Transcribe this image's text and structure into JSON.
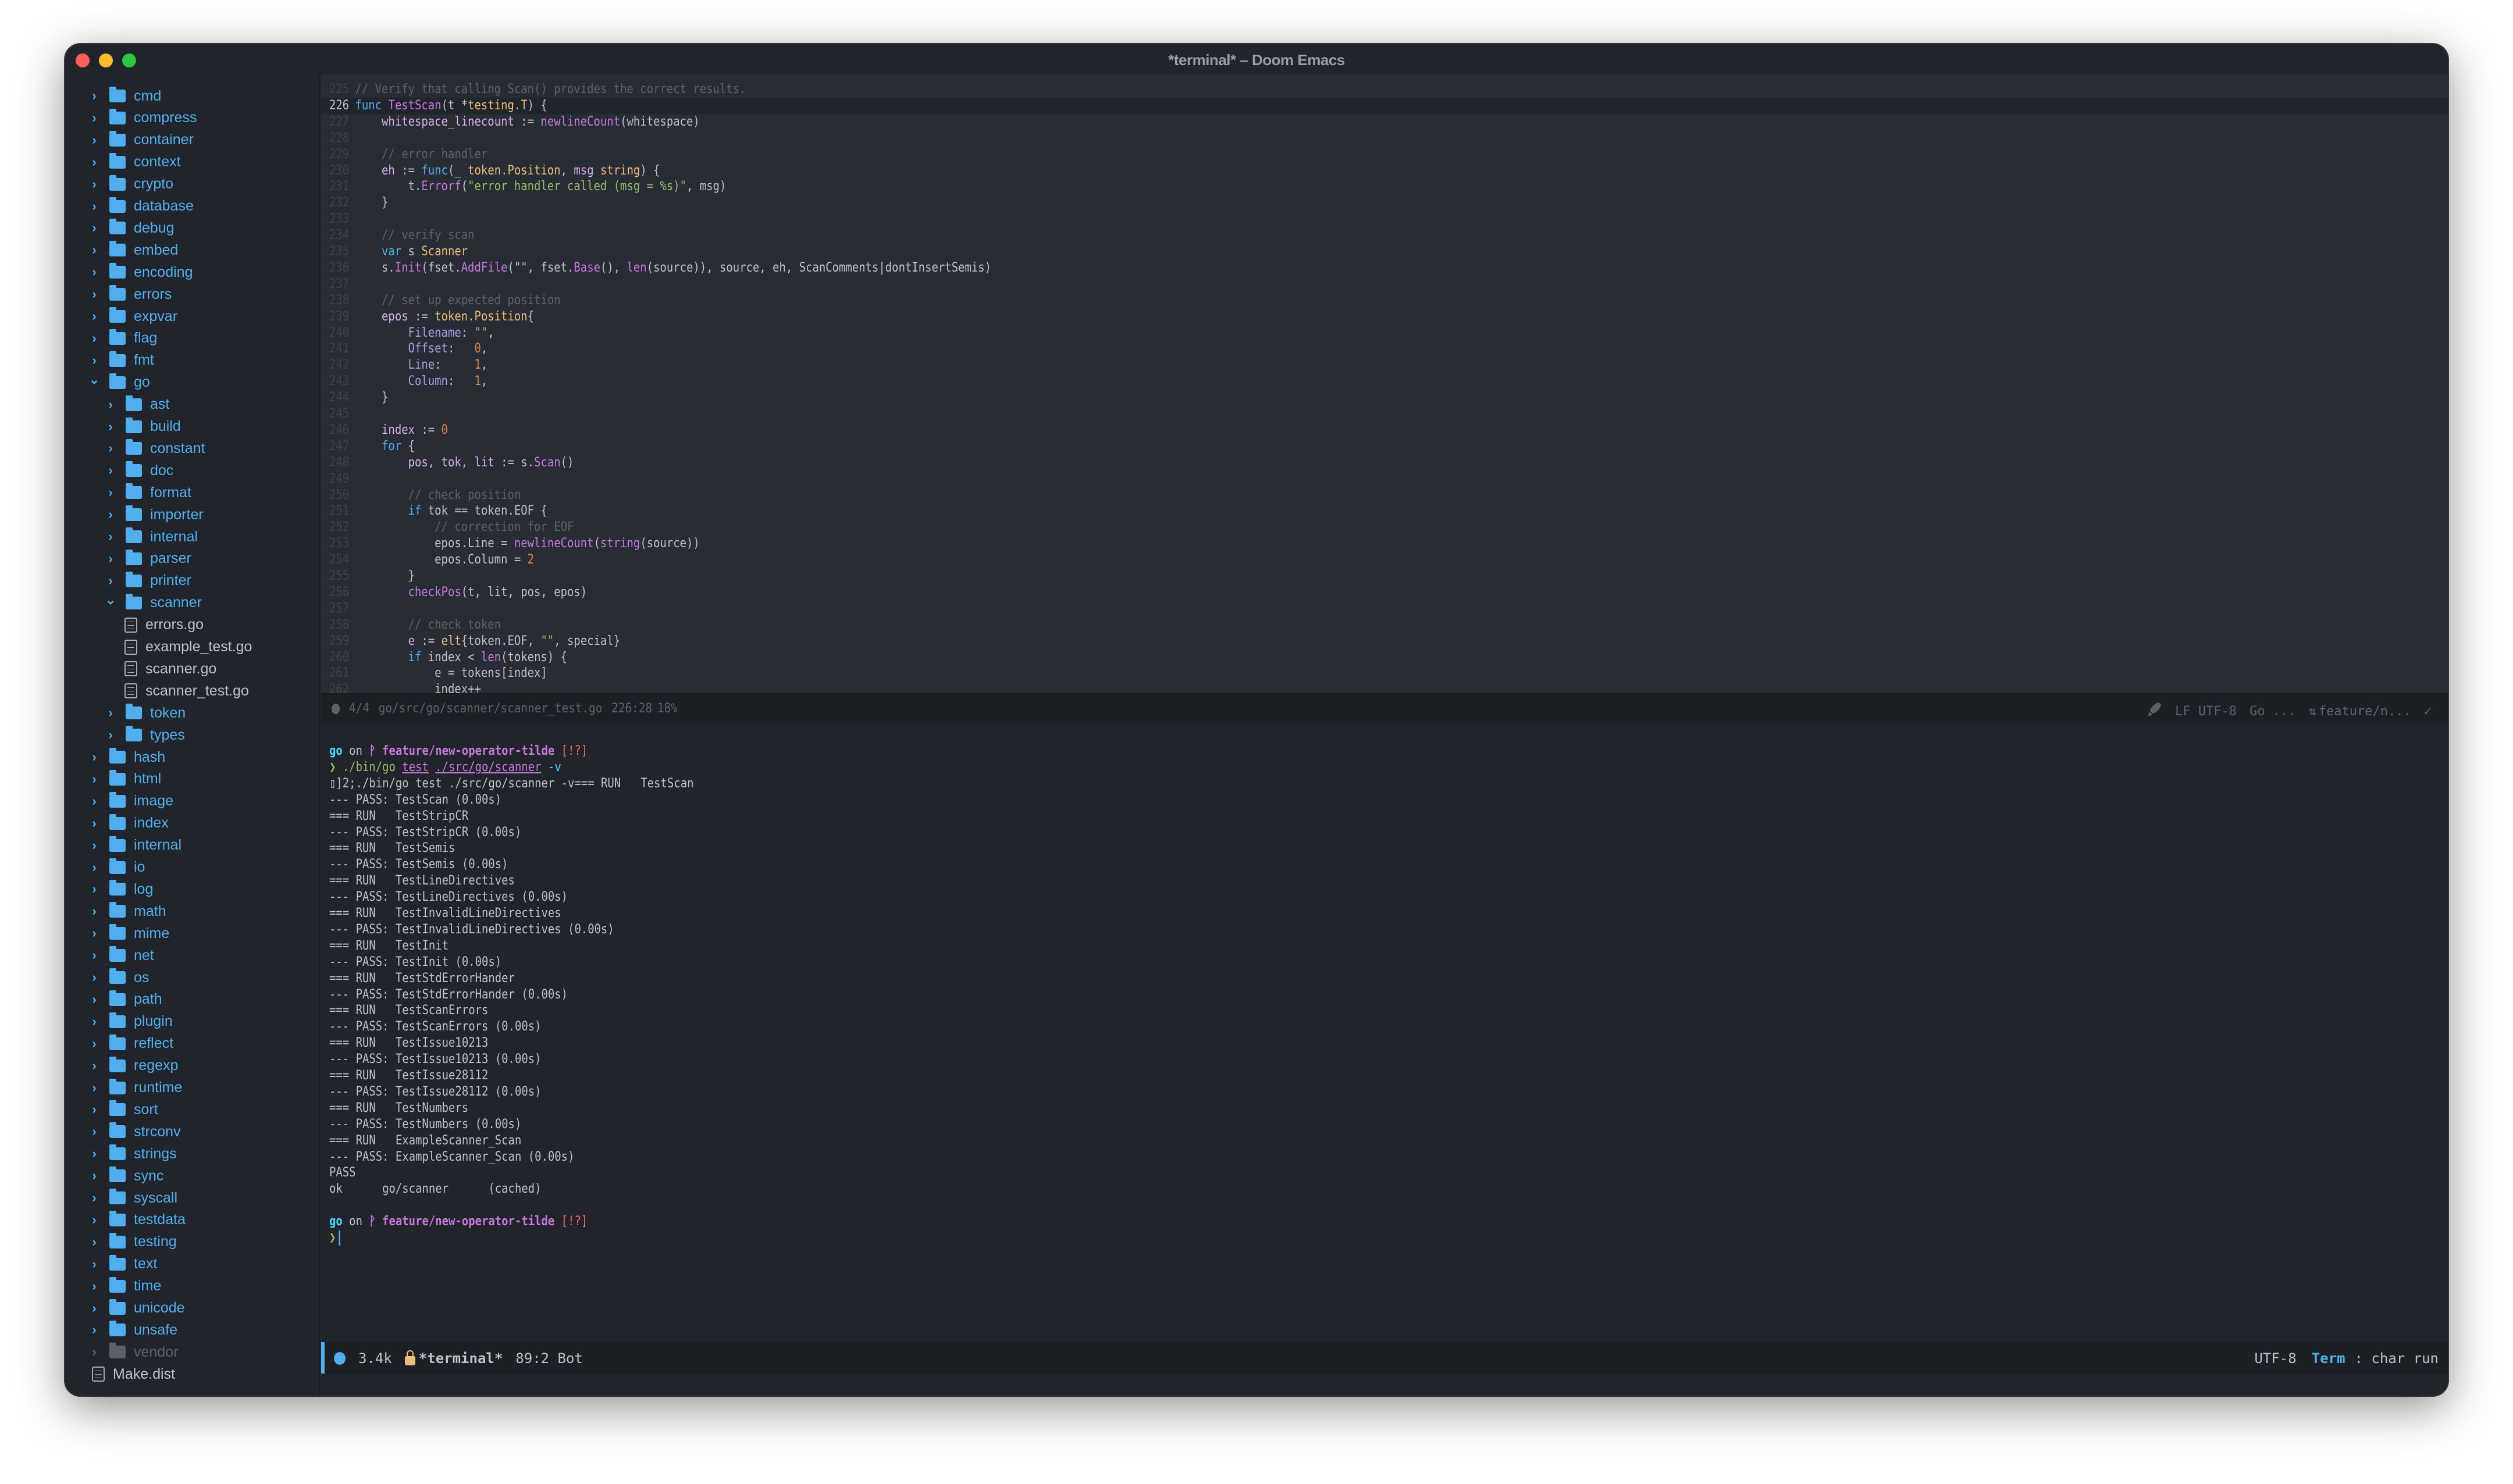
{
  "window": {
    "title": "*terminal* – Doom Emacs"
  },
  "sidebar": {
    "items": [
      {
        "label": "cmd",
        "type": "folder",
        "depth": 0,
        "expanded": false
      },
      {
        "label": "compress",
        "type": "folder",
        "depth": 0,
        "expanded": false
      },
      {
        "label": "container",
        "type": "folder",
        "depth": 0,
        "expanded": false
      },
      {
        "label": "context",
        "type": "folder",
        "depth": 0,
        "expanded": false
      },
      {
        "label": "crypto",
        "type": "folder",
        "depth": 0,
        "expanded": false
      },
      {
        "label": "database",
        "type": "folder",
        "depth": 0,
        "expanded": false
      },
      {
        "label": "debug",
        "type": "folder",
        "depth": 0,
        "expanded": false
      },
      {
        "label": "embed",
        "type": "folder",
        "depth": 0,
        "expanded": false
      },
      {
        "label": "encoding",
        "type": "folder",
        "depth": 0,
        "expanded": false
      },
      {
        "label": "errors",
        "type": "folder",
        "depth": 0,
        "expanded": false
      },
      {
        "label": "expvar",
        "type": "folder",
        "depth": 0,
        "expanded": false
      },
      {
        "label": "flag",
        "type": "folder",
        "depth": 0,
        "expanded": false
      },
      {
        "label": "fmt",
        "type": "folder",
        "depth": 0,
        "expanded": false
      },
      {
        "label": "go",
        "type": "folder",
        "depth": 0,
        "expanded": true
      },
      {
        "label": "ast",
        "type": "folder",
        "depth": 1,
        "expanded": false
      },
      {
        "label": "build",
        "type": "folder",
        "depth": 1,
        "expanded": false
      },
      {
        "label": "constant",
        "type": "folder",
        "depth": 1,
        "expanded": false
      },
      {
        "label": "doc",
        "type": "folder",
        "depth": 1,
        "expanded": false
      },
      {
        "label": "format",
        "type": "folder",
        "depth": 1,
        "expanded": false
      },
      {
        "label": "importer",
        "type": "folder",
        "depth": 1,
        "expanded": false
      },
      {
        "label": "internal",
        "type": "folder",
        "depth": 1,
        "expanded": false
      },
      {
        "label": "parser",
        "type": "folder",
        "depth": 1,
        "expanded": false
      },
      {
        "label": "printer",
        "type": "folder",
        "depth": 1,
        "expanded": false
      },
      {
        "label": "scanner",
        "type": "folder",
        "depth": 1,
        "expanded": true
      },
      {
        "label": "errors.go",
        "type": "file",
        "depth": 2
      },
      {
        "label": "example_test.go",
        "type": "file",
        "depth": 2
      },
      {
        "label": "scanner.go",
        "type": "file",
        "depth": 2
      },
      {
        "label": "scanner_test.go",
        "type": "file",
        "depth": 2
      },
      {
        "label": "token",
        "type": "folder",
        "depth": 1,
        "expanded": false
      },
      {
        "label": "types",
        "type": "folder",
        "depth": 1,
        "expanded": false
      },
      {
        "label": "hash",
        "type": "folder",
        "depth": 0,
        "expanded": false
      },
      {
        "label": "html",
        "type": "folder",
        "depth": 0,
        "expanded": false
      },
      {
        "label": "image",
        "type": "folder",
        "depth": 0,
        "expanded": false
      },
      {
        "label": "index",
        "type": "folder",
        "depth": 0,
        "expanded": false
      },
      {
        "label": "internal",
        "type": "folder",
        "depth": 0,
        "expanded": false
      },
      {
        "label": "io",
        "type": "folder",
        "depth": 0,
        "expanded": false
      },
      {
        "label": "log",
        "type": "folder",
        "depth": 0,
        "expanded": false
      },
      {
        "label": "math",
        "type": "folder",
        "depth": 0,
        "expanded": false
      },
      {
        "label": "mime",
        "type": "folder",
        "depth": 0,
        "expanded": false
      },
      {
        "label": "net",
        "type": "folder",
        "depth": 0,
        "expanded": false
      },
      {
        "label": "os",
        "type": "folder",
        "depth": 0,
        "expanded": false
      },
      {
        "label": "path",
        "type": "folder",
        "depth": 0,
        "expanded": false
      },
      {
        "label": "plugin",
        "type": "folder",
        "depth": 0,
        "expanded": false
      },
      {
        "label": "reflect",
        "type": "folder",
        "depth": 0,
        "expanded": false
      },
      {
        "label": "regexp",
        "type": "folder",
        "depth": 0,
        "expanded": false
      },
      {
        "label": "runtime",
        "type": "folder",
        "depth": 0,
        "expanded": false
      },
      {
        "label": "sort",
        "type": "folder",
        "depth": 0,
        "expanded": false
      },
      {
        "label": "strconv",
        "type": "folder",
        "depth": 0,
        "expanded": false
      },
      {
        "label": "strings",
        "type": "folder",
        "depth": 0,
        "expanded": false
      },
      {
        "label": "sync",
        "type": "folder",
        "depth": 0,
        "expanded": false
      },
      {
        "label": "syscall",
        "type": "folder",
        "depth": 0,
        "expanded": false
      },
      {
        "label": "testdata",
        "type": "folder",
        "depth": 0,
        "expanded": false
      },
      {
        "label": "testing",
        "type": "folder",
        "depth": 0,
        "expanded": false
      },
      {
        "label": "text",
        "type": "folder",
        "depth": 0,
        "expanded": false
      },
      {
        "label": "time",
        "type": "folder",
        "depth": 0,
        "expanded": false
      },
      {
        "label": "unicode",
        "type": "folder",
        "depth": 0,
        "expanded": false
      },
      {
        "label": "unsafe",
        "type": "folder",
        "depth": 0,
        "expanded": false
      },
      {
        "label": "vendor",
        "type": "folder",
        "depth": 0,
        "expanded": false,
        "dim": true
      },
      {
        "label": "Make.dist",
        "type": "file",
        "depth": 0,
        "root_file": true
      }
    ]
  },
  "editor": {
    "current_line": 226,
    "lines": [
      {
        "n": "225",
        "tokens": [
          [
            "cm",
            "// Verify that calling Scan() provides the correct results."
          ]
        ]
      },
      {
        "n": "226",
        "tokens": [
          [
            "kw",
            "func "
          ],
          [
            "fn",
            "TestScan"
          ],
          [
            "",
            "(t *"
          ],
          [
            "ty",
            "testing.T"
          ],
          [
            "",
            ") {"
          ]
        ]
      },
      {
        "n": "227",
        "tokens": [
          [
            "",
            "    "
          ],
          [
            "var",
            "whitespace_linecount"
          ],
          [
            "",
            " := "
          ],
          [
            "fn",
            "newlineCount"
          ],
          [
            "",
            "(whitespace)"
          ]
        ]
      },
      {
        "n": "228",
        "tokens": []
      },
      {
        "n": "229",
        "tokens": [
          [
            "",
            "    "
          ],
          [
            "cm",
            "// error handler"
          ]
        ]
      },
      {
        "n": "230",
        "tokens": [
          [
            "",
            "    "
          ],
          [
            "var",
            "eh"
          ],
          [
            "",
            " := "
          ],
          [
            "kw",
            "func"
          ],
          [
            "",
            "(_ "
          ],
          [
            "ty",
            "token.Position"
          ],
          [
            "",
            ", "
          ],
          [
            "var",
            "msg"
          ],
          [
            "",
            " "
          ],
          [
            "ty",
            "string"
          ],
          [
            "",
            ") {"
          ]
        ]
      },
      {
        "n": "231",
        "tokens": [
          [
            "",
            "        t."
          ],
          [
            "fn",
            "Errorf"
          ],
          [
            "",
            "("
          ],
          [
            "str",
            "\"error handler called (msg = %s)\""
          ],
          [
            "",
            ", msg)"
          ]
        ]
      },
      {
        "n": "232",
        "tokens": [
          [
            "",
            "    }"
          ]
        ]
      },
      {
        "n": "233",
        "tokens": []
      },
      {
        "n": "234",
        "tokens": [
          [
            "",
            "    "
          ],
          [
            "cm",
            "// verify scan"
          ]
        ]
      },
      {
        "n": "235",
        "tokens": [
          [
            "",
            "    "
          ],
          [
            "kw",
            "var"
          ],
          [
            "",
            " s "
          ],
          [
            "ty",
            "Scanner"
          ]
        ]
      },
      {
        "n": "236",
        "tokens": [
          [
            "",
            "    s."
          ],
          [
            "fn",
            "Init"
          ],
          [
            "",
            "(fset."
          ],
          [
            "fn",
            "AddFile"
          ],
          [
            "",
            "(\"\", fset."
          ],
          [
            "fn",
            "Base"
          ],
          [
            "",
            "(), "
          ],
          [
            "fn",
            "len"
          ],
          [
            "",
            "(source)), source, eh, ScanComments|dontInsertSemis)"
          ]
        ]
      },
      {
        "n": "237",
        "tokens": []
      },
      {
        "n": "238",
        "tokens": [
          [
            "",
            "    "
          ],
          [
            "cm",
            "// set up expected position"
          ]
        ]
      },
      {
        "n": "239",
        "tokens": [
          [
            "",
            "    "
          ],
          [
            "var",
            "epos"
          ],
          [
            "",
            " := "
          ],
          [
            "ty",
            "token.Position"
          ],
          [
            "",
            "{"
          ]
        ]
      },
      {
        "n": "240",
        "tokens": [
          [
            "",
            "        "
          ],
          [
            "fld",
            "Filename"
          ],
          [
            "",
            ": "
          ],
          [
            "str",
            "\"\""
          ],
          [
            "",
            ","
          ]
        ]
      },
      {
        "n": "241",
        "tokens": [
          [
            "",
            "        "
          ],
          [
            "fld",
            "Offset"
          ],
          [
            "",
            ":   "
          ],
          [
            "num",
            "0"
          ],
          [
            "",
            ","
          ]
        ]
      },
      {
        "n": "242",
        "tokens": [
          [
            "",
            "        "
          ],
          [
            "fld",
            "Line"
          ],
          [
            "",
            ":     "
          ],
          [
            "num",
            "1"
          ],
          [
            "",
            ","
          ]
        ]
      },
      {
        "n": "243",
        "tokens": [
          [
            "",
            "        "
          ],
          [
            "fld",
            "Column"
          ],
          [
            "",
            ":   "
          ],
          [
            "num",
            "1"
          ],
          [
            "",
            ","
          ]
        ]
      },
      {
        "n": "244",
        "tokens": [
          [
            "",
            "    }"
          ]
        ]
      },
      {
        "n": "245",
        "tokens": []
      },
      {
        "n": "246",
        "tokens": [
          [
            "",
            "    "
          ],
          [
            "var",
            "index"
          ],
          [
            "",
            " := "
          ],
          [
            "num",
            "0"
          ]
        ]
      },
      {
        "n": "247",
        "tokens": [
          [
            "",
            "    "
          ],
          [
            "kw",
            "for"
          ],
          [
            "",
            " {"
          ]
        ]
      },
      {
        "n": "248",
        "tokens": [
          [
            "",
            "        "
          ],
          [
            "var",
            "pos"
          ],
          [
            "",
            ", "
          ],
          [
            "var",
            "tok"
          ],
          [
            "",
            ", "
          ],
          [
            "var",
            "lit"
          ],
          [
            "",
            " := s."
          ],
          [
            "fn",
            "Scan"
          ],
          [
            "",
            "()"
          ]
        ]
      },
      {
        "n": "249",
        "tokens": []
      },
      {
        "n": "250",
        "tokens": [
          [
            "",
            "        "
          ],
          [
            "cm",
            "// check position"
          ]
        ]
      },
      {
        "n": "251",
        "tokens": [
          [
            "",
            "        "
          ],
          [
            "kw",
            "if"
          ],
          [
            "",
            " tok == token.EOF {"
          ]
        ]
      },
      {
        "n": "252",
        "tokens": [
          [
            "",
            "            "
          ],
          [
            "cm",
            "// correction for EOF"
          ]
        ]
      },
      {
        "n": "253",
        "tokens": [
          [
            "",
            "            epos.Line = "
          ],
          [
            "fn",
            "newlineCount"
          ],
          [
            "",
            "("
          ],
          [
            "fn",
            "string"
          ],
          [
            "",
            "(source))"
          ]
        ]
      },
      {
        "n": "254",
        "tokens": [
          [
            "",
            "            epos.Column = "
          ],
          [
            "num",
            "2"
          ]
        ]
      },
      {
        "n": "255",
        "tokens": [
          [
            "",
            "        }"
          ]
        ]
      },
      {
        "n": "256",
        "tokens": [
          [
            "",
            "        "
          ],
          [
            "fn",
            "checkPos"
          ],
          [
            "",
            "(t, lit, pos, epos)"
          ]
        ]
      },
      {
        "n": "257",
        "tokens": []
      },
      {
        "n": "258",
        "tokens": [
          [
            "",
            "        "
          ],
          [
            "cm",
            "// check token"
          ]
        ]
      },
      {
        "n": "259",
        "tokens": [
          [
            "",
            "        "
          ],
          [
            "var",
            "e"
          ],
          [
            "",
            " := "
          ],
          [
            "ty",
            "elt"
          ],
          [
            "",
            "{token.EOF, "
          ],
          [
            "str",
            "\"\""
          ],
          [
            "",
            ", special}"
          ]
        ]
      },
      {
        "n": "260",
        "tokens": [
          [
            "",
            "        "
          ],
          [
            "kw",
            "if"
          ],
          [
            "",
            " index < "
          ],
          [
            "fn",
            "len"
          ],
          [
            "",
            "(tokens) {"
          ]
        ]
      },
      {
        "n": "261",
        "tokens": [
          [
            "",
            "            e = tokens[index]"
          ]
        ]
      },
      {
        "n": "262",
        "tokens": [
          [
            "",
            "            index++"
          ]
        ]
      }
    ]
  },
  "editor_modeline": {
    "buffer_index": "4/4",
    "file_path": "go/src/go/scanner/scanner_test.go",
    "position": "226:28",
    "percent": "18%",
    "eol_encoding": "LF UTF-8",
    "major_mode": "Go ...",
    "vcs_branch": "feature/n...",
    "check_status": "✓"
  },
  "terminal": {
    "prompt": {
      "dir": "go",
      "on": "on",
      "branch_icon": "ᚹ",
      "branch": "feature/new-operator-tilde",
      "status": "[!?]",
      "arrow": "❯"
    },
    "command": {
      "bin": "./bin/go",
      "sub": "test",
      "path": "./src/go/scanner",
      "flag": "-v"
    },
    "output_lines": [
      "▯]2;./bin/go test ./src/go/scanner -v=== RUN   TestScan",
      "--- PASS: TestScan (0.00s)",
      "=== RUN   TestStripCR",
      "--- PASS: TestStripCR (0.00s)",
      "=== RUN   TestSemis",
      "--- PASS: TestSemis (0.00s)",
      "=== RUN   TestLineDirectives",
      "--- PASS: TestLineDirectives (0.00s)",
      "=== RUN   TestInvalidLineDirectives",
      "--- PASS: TestInvalidLineDirectives (0.00s)",
      "=== RUN   TestInit",
      "--- PASS: TestInit (0.00s)",
      "=== RUN   TestStdErrorHander",
      "--- PASS: TestStdErrorHander (0.00s)",
      "=== RUN   TestScanErrors",
      "--- PASS: TestScanErrors (0.00s)",
      "=== RUN   TestIssue10213",
      "--- PASS: TestIssue10213 (0.00s)",
      "=== RUN   TestIssue28112",
      "--- PASS: TestIssue28112 (0.00s)",
      "=== RUN   TestNumbers",
      "--- PASS: TestNumbers (0.00s)",
      "=== RUN   ExampleScanner_Scan",
      "--- PASS: ExampleScanner_Scan (0.00s)",
      "PASS",
      "ok      go/scanner      (cached)"
    ]
  },
  "terminal_modeline": {
    "size": "3.4k",
    "buffer_name": "*terminal*",
    "position": "89:2 Bot",
    "encoding": "UTF-8",
    "mode": "Term",
    "submode": ": char run"
  },
  "colors": {
    "accent": "#51afef",
    "background": "#282c34",
    "sidebar_bg": "#21242b",
    "keyword": "#51afef",
    "function": "#c678dd",
    "type": "#ecbe7b",
    "string": "#98be65",
    "number": "#da8548",
    "comment": "#5b6268"
  }
}
